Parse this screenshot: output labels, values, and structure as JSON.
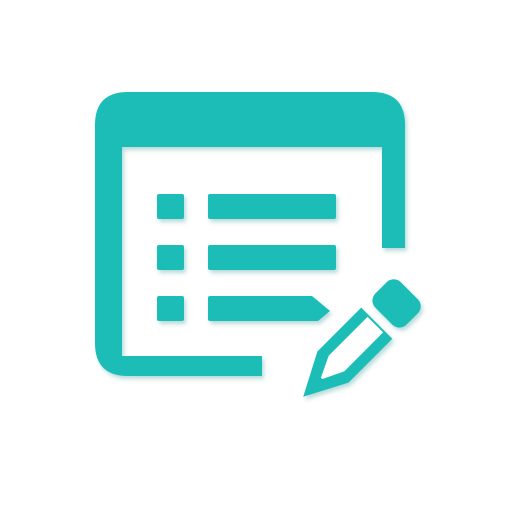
{
  "icon": {
    "name": "edit-list-icon",
    "color": "#1bbdb7",
    "shadow_color": "#0f7d79"
  }
}
